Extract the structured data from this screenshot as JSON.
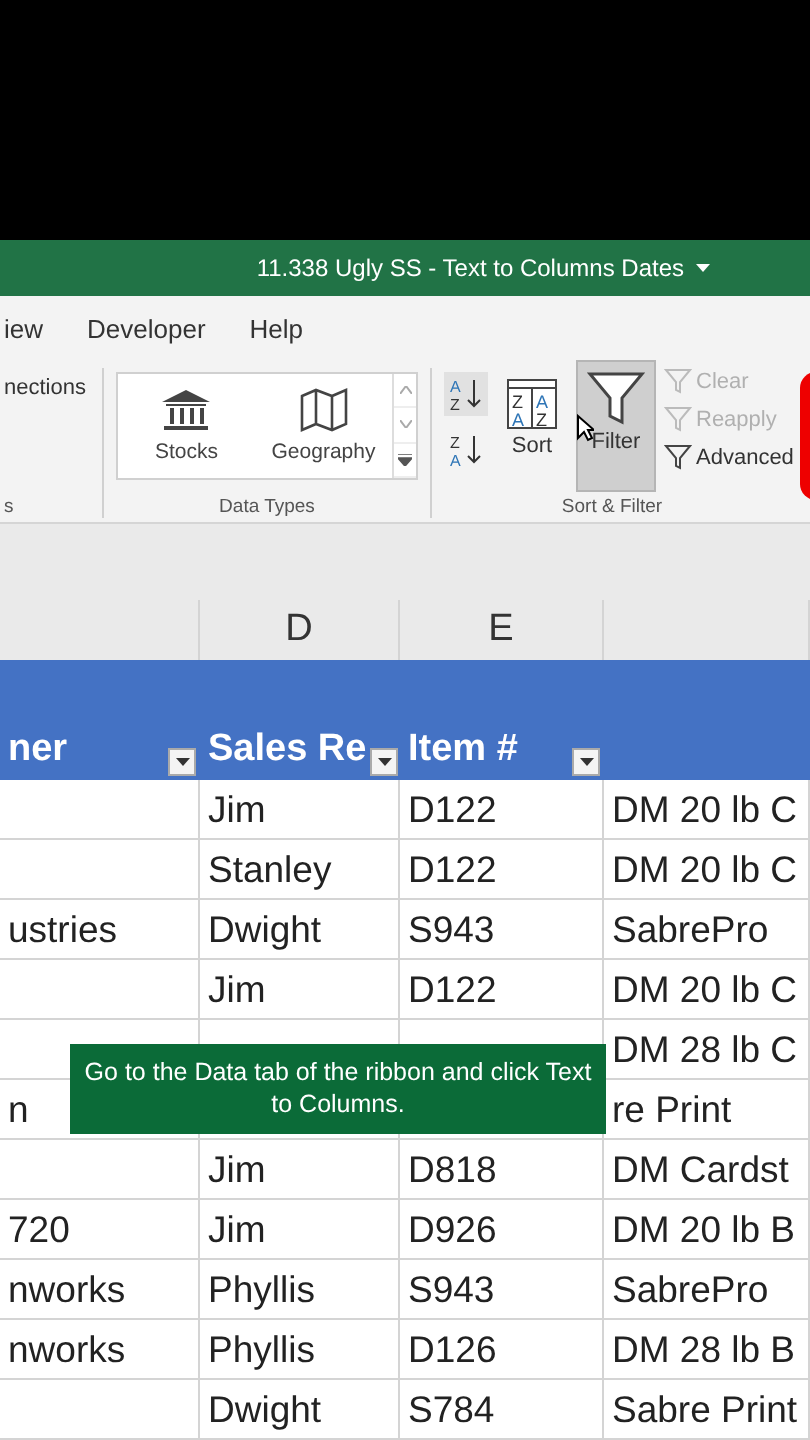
{
  "title_bar": {
    "title": "11.338 Ugly SS - Text to Columns Dates"
  },
  "ribbon_tabs": [
    "iew",
    "Developer",
    "Help"
  ],
  "ribbon": {
    "connections": {
      "label": "nections",
      "group_label": "s"
    },
    "data_types": {
      "group_label": "Data Types",
      "items": [
        "Stocks",
        "Geography"
      ]
    },
    "sort_filter": {
      "group_label": "Sort & Filter",
      "sort_ascending_letters": [
        "A",
        "Z"
      ],
      "sort_descending_letters": [
        "Z",
        "A"
      ],
      "sort_dialog_letters": [
        "Z",
        "A",
        "A",
        "Z"
      ],
      "sort_label": "Sort",
      "filter": {
        "label": "Filter",
        "pressed": true
      },
      "commands": [
        {
          "label": "Clear",
          "disabled": true
        },
        {
          "label": "Reapply",
          "disabled": true
        },
        {
          "label": "Advanced",
          "disabled": false
        }
      ]
    }
  },
  "sheet": {
    "column_headers": [
      "D",
      "E"
    ],
    "table_header": [
      {
        "label": "ner",
        "filter": true
      },
      {
        "label": "Sales Re",
        "filter": true
      },
      {
        "label": "Item #",
        "filter": true
      }
    ],
    "rows": [
      {
        "sales_rep": "Jim",
        "item": "D122",
        "column_f": "DM 20 lb C"
      },
      {
        "sales_rep": "Stanley",
        "item": "D122",
        "column_f": "DM 20 lb C"
      },
      {
        "column_c": "ustries",
        "sales_rep": "Dwight",
        "item": "S943",
        "column_f": "SabrePro"
      },
      {
        "sales_rep": "Jim",
        "item": "D122",
        "column_f": "DM 20 lb C"
      },
      {
        "column_f": "DM 28 lb C"
      },
      {
        "column_c": "n",
        "column_f": "re Print"
      },
      {
        "sales_rep": "Jim",
        "item": "D818",
        "column_f": "DM Cardst"
      },
      {
        "column_c": "720",
        "sales_rep": "Jim",
        "item": "D926",
        "column_f": "DM 20 lb B"
      },
      {
        "column_c": "nworks",
        "sales_rep": "Phyllis",
        "item": "S943",
        "column_f": "SabrePro"
      },
      {
        "column_c": "nworks",
        "sales_rep": "Phyllis",
        "item": "D126",
        "column_f": "DM 28 lb B"
      },
      {
        "sales_rep": "Dwight",
        "item": "S784",
        "column_f": "Sabre Print"
      }
    ]
  },
  "caption": {
    "text": "Go to the Data tab of the ribbon and click Text to Columns."
  }
}
